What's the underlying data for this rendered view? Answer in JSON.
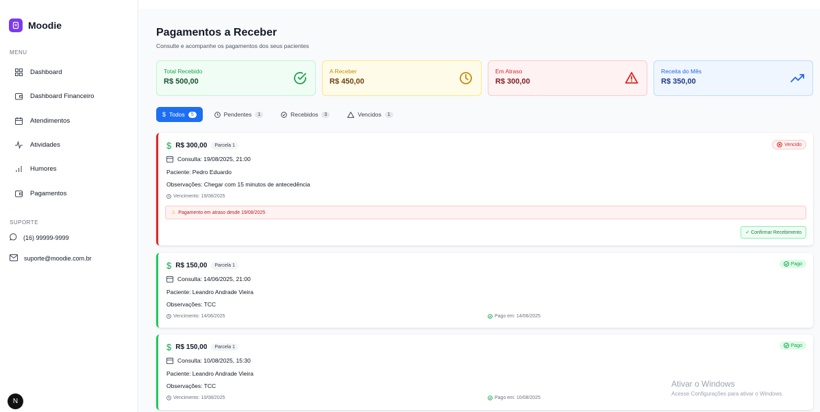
{
  "brand": {
    "name": "Moodie"
  },
  "sidebar": {
    "menu_label": "MENU",
    "items": [
      {
        "label": "Dashboard",
        "icon": "grid-icon"
      },
      {
        "label": "Dashboard Financeiro",
        "icon": "wallet-icon"
      },
      {
        "label": "Atendimentos",
        "icon": "calendar-icon"
      },
      {
        "label": "Atividades",
        "icon": "activity-icon"
      },
      {
        "label": "Humores",
        "icon": "bar-chart-icon"
      },
      {
        "label": "Pagamentos",
        "icon": "wallet-icon"
      }
    ],
    "support_label": "SUPORTE",
    "support_phone": "(16) 99999-9999",
    "support_email": "suporte@moodie.com.br",
    "avatar_letter": "N"
  },
  "header": {
    "title": "Pagamentos a Receber",
    "subtitle": "Consulte e acompanhe os pagamentos dos seus pacientes"
  },
  "stats": [
    {
      "label": "Total Recebido",
      "value": "R$ 500,00",
      "icon": "check-circle-icon",
      "color": "#16a34a"
    },
    {
      "label": "A Receber",
      "value": "R$ 450,00",
      "icon": "clock-icon",
      "color": "#ca8a04"
    },
    {
      "label": "Em Atraso",
      "value": "R$ 300,00",
      "icon": "alert-triangle-icon",
      "color": "#dc2626"
    },
    {
      "label": "Receita do Mês",
      "value": "R$ 350,00",
      "icon": "trending-up-icon",
      "color": "#2563eb"
    }
  ],
  "tabs": [
    {
      "label": "Todos",
      "count": "5",
      "active": true
    },
    {
      "label": "Pendentes",
      "count": "1"
    },
    {
      "label": "Recebidos",
      "count": "3"
    },
    {
      "label": "Vencidos",
      "count": "1"
    }
  ],
  "payments": [
    {
      "amount": "R$ 300,00",
      "parcela": "Parcela 1",
      "consulta": "Consulta: 19/08/2025, 21:00",
      "paciente": "Paciente: Pedro Eduardo",
      "observacoes": "Observações: Chegar com 15 minutos de antecedência",
      "vencimento": "Vencimento: 19/08/2025",
      "status": "Vencido",
      "alert": "Pagamento em atraso desde 19/08/2025",
      "action": "✓ Confirmar Recebimento"
    },
    {
      "amount": "R$ 150,00",
      "parcela": "Parcela 1",
      "consulta": "Consulta: 14/06/2025, 21:00",
      "paciente": "Paciente: Leandro Andrade Vieira",
      "observacoes": "Observações: TCC",
      "vencimento": "Vencimento: 14/06/2025",
      "pago_em": "Pago em: 14/06/2025",
      "status": "Pago"
    },
    {
      "amount": "R$ 150,00",
      "parcela": "Parcela 1",
      "consulta": "Consulta: 10/08/2025, 15:30",
      "paciente": "Paciente: Leandro Andrade Vieira",
      "observacoes": "Observações: TCC",
      "vencimento": "Vencimento: 10/08/2025",
      "pago_em": "Pago em: 10/08/2025",
      "status": "Pago"
    }
  ],
  "watermark": {
    "line1": "Ativar o Windows",
    "line2": "Acesse Configurações para ativar o Windows."
  }
}
